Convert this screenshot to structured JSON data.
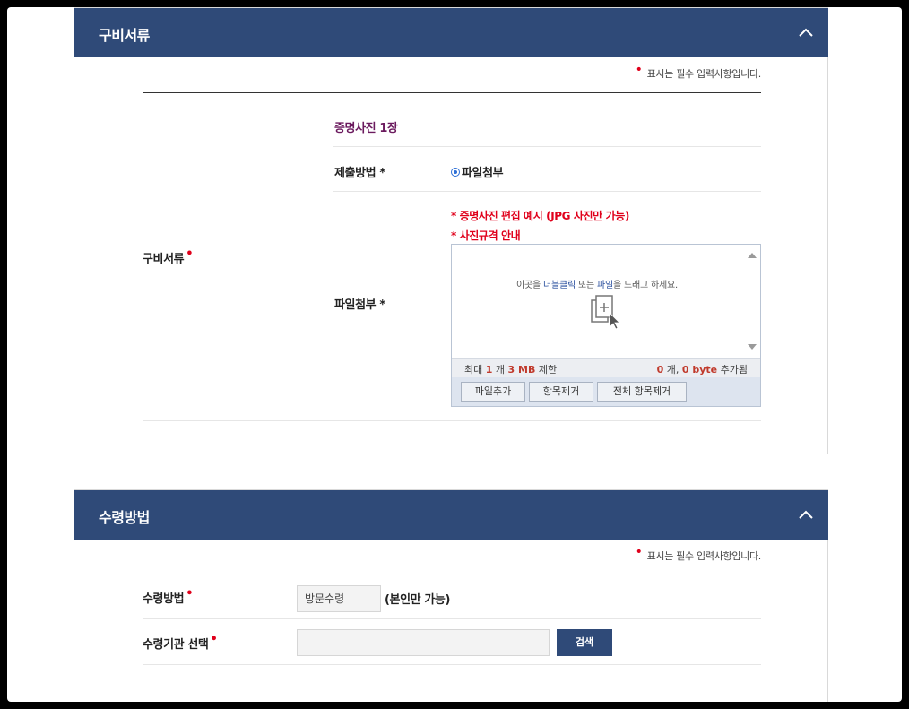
{
  "required_note": "표시는 필수 입력사항입니다.",
  "documents": {
    "title": "구비서류",
    "row_label": "구비서류",
    "doc_name": "증명사진 1장",
    "method_label": "제출방법 *",
    "method_option": "파일첨부",
    "attach_label": "파일첨부 *",
    "link_edit_example": "* 증명사진 편집 예시 (JPG 사진만 가능)",
    "link_photo_spec": "* 사진규격 안내",
    "uploader": {
      "drop_text_prefix": "이곳을 ",
      "drop_text_dblclick": "더블클릭",
      "drop_text_mid": " 또는 ",
      "drop_text_file": "파일",
      "drop_text_suffix": "을 드래그 하세요.",
      "limit_prefix": "최대",
      "limit_count": "1",
      "limit_unit_count": "개",
      "limit_size": "3 MB",
      "limit_suffix": "제한",
      "added_count": "0",
      "added_unit": "개,",
      "added_bytes": "0 byte",
      "added_suffix": "추가됨",
      "btn_add": "파일추가",
      "btn_remove": "항목제거",
      "btn_remove_all": "전체 항목제거"
    }
  },
  "receipt": {
    "title": "수령방법",
    "method_label": "수령방법",
    "method_value": "방문수령",
    "method_note": "(본인만 가능)",
    "agency_label": "수령기관 선택",
    "agency_value": "",
    "search_label": "검색"
  }
}
